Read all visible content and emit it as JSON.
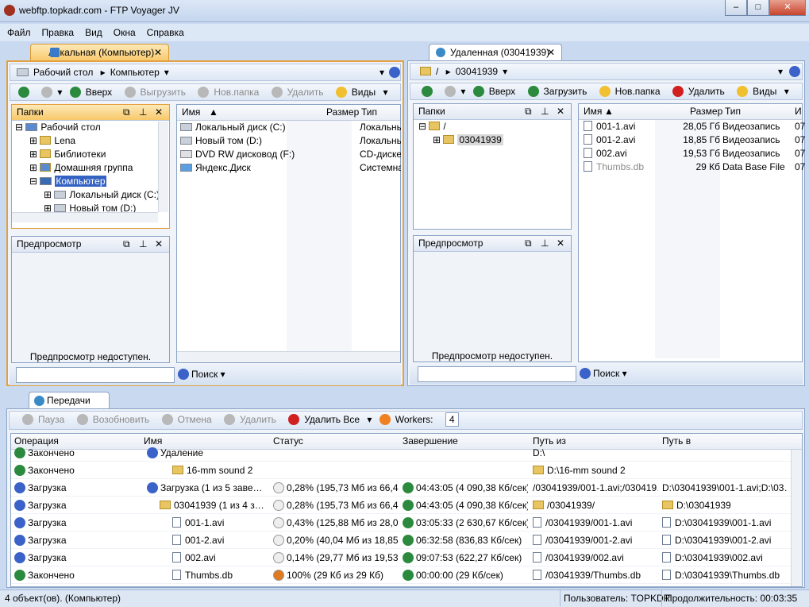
{
  "window": {
    "title": "webftp.topkadr.com - FTP Voyager JV",
    "min": "–",
    "max": "□",
    "close": "✕"
  },
  "menu": [
    "Файл",
    "Правка",
    "Вид",
    "Окна",
    "Справка"
  ],
  "local": {
    "tab": "Локальная (Компьютер)",
    "path": [
      "Рабочий стол",
      "Компьютер"
    ],
    "toolbar": [
      "Вверх",
      "Выгрузить",
      "Нов.папка",
      "Удалить",
      "Виды"
    ],
    "folders_title": "Папки",
    "tree": [
      "Рабочий стол",
      "Lena",
      "Библиотеки",
      "Домашняя группа",
      "Компьютер",
      "Локальный диск (C:)",
      "Новый том (D:)"
    ],
    "preview_title": "Предпросмотр",
    "preview_text": "Предпросмотр недоступен.",
    "columns": [
      "Имя",
      "Размер",
      "Тип"
    ],
    "files": [
      {
        "name": "Локальный диск (C:)",
        "size": "",
        "type": "Локальны"
      },
      {
        "name": "Новый том (D:)",
        "size": "",
        "type": "Локальны"
      },
      {
        "name": "DVD RW дисковод (F:)",
        "size": "",
        "type": "CD-диске"
      },
      {
        "name": "Яндекс.Диск",
        "size": "",
        "type": "Системна"
      }
    ],
    "search_label": "Поиск"
  },
  "remote": {
    "tab": "Удаленная (03041939)",
    "path": [
      "/",
      "03041939"
    ],
    "toolbar": [
      "Вверх",
      "Загрузить",
      "Нов.папка",
      "Удалить",
      "Виды"
    ],
    "folders_title": "Папки",
    "tree": [
      "/",
      "03041939"
    ],
    "preview_title": "Предпросмотр",
    "preview_text": "Предпросмотр недоступен.",
    "columns": [
      "Имя",
      "Размер",
      "Тип",
      "И"
    ],
    "files": [
      {
        "name": "001-1.avi",
        "size": "28,05 Гб",
        "type": "Видеозапись",
        "extra": "07"
      },
      {
        "name": "001-2.avi",
        "size": "18,85 Гб",
        "type": "Видеозапись",
        "extra": "07"
      },
      {
        "name": "002.avi",
        "size": "19,53 Гб",
        "type": "Видеозапись",
        "extra": "07"
      },
      {
        "name": "Thumbs.db",
        "size": "29 Кб",
        "type": "Data Base File",
        "extra": "07"
      }
    ],
    "search_label": "Поиск"
  },
  "transfers": {
    "tab": "Передачи",
    "toolbar": [
      "Пауза",
      "Возобновить",
      "Отмена",
      "Удалить",
      "Удалить Все"
    ],
    "workers_label": "Workers:",
    "workers_value": "4",
    "columns": [
      "Операция",
      "Имя",
      "Статус",
      "Завершение",
      "Путь из",
      "Путь в"
    ],
    "rows": [
      {
        "op": "Закончено",
        "name": "Удаление",
        "status": "",
        "finish": "",
        "from": "D:\\",
        "to": "",
        "icon": "g"
      },
      {
        "op": "Закончено",
        "name": "16-mm sound 2",
        "status": "",
        "finish": "",
        "from": "D:\\16-mm sound 2",
        "to": "",
        "icon": "g"
      },
      {
        "op": "Загрузка",
        "name": "Загрузка  (1 из 5 заве…",
        "status": "0,28% (195,73 Мб из 66,4…",
        "finish": "04:43:05 (4 090,38 Кб/сек)",
        "from": "/03041939/001-1.avi;/030419…",
        "to": "D:\\03041939\\001-1.avi;D:\\03…",
        "icon": "b"
      },
      {
        "op": "Загрузка",
        "name": "03041939 (1 из 4 з…",
        "status": "0,28% (195,73 Мб из 66,4…",
        "finish": "04:43:05 (4 090,38 Кб/сек)",
        "from": "/03041939/",
        "to": "D:\\03041939",
        "icon": "b"
      },
      {
        "op": "Загрузка",
        "name": "001-1.avi",
        "status": "0,43% (125,88 Мб из 28,0…",
        "finish": "03:05:33 (2 630,67 Кб/сек)",
        "from": "/03041939/001-1.avi",
        "to": "D:\\03041939\\001-1.avi",
        "icon": "b"
      },
      {
        "op": "Загрузка",
        "name": "001-2.avi",
        "status": "0,20% (40,04 Мб из 18,85…",
        "finish": "06:32:58 (836,83 Кб/сек)",
        "from": "/03041939/001-2.avi",
        "to": "D:\\03041939\\001-2.avi",
        "icon": "b"
      },
      {
        "op": "Загрузка",
        "name": "002.avi",
        "status": "0,14% (29,77 Мб из 19,53…",
        "finish": "09:07:53 (622,27 Кб/сек)",
        "from": "/03041939/002.avi",
        "to": "D:\\03041939\\002.avi",
        "icon": "b"
      },
      {
        "op": "Закончено",
        "name": "Thumbs.db",
        "status": "100% (29 Кб из 29 Кб)",
        "finish": "00:00:00 (29 Кб/сек)",
        "from": "/03041939/Thumbs.db",
        "to": "D:\\03041939\\Thumbs.db",
        "icon": "g"
      }
    ]
  },
  "statusbar": {
    "left": "4 объект(ов).  (Компьютер)",
    "user": "Пользователь: TOPKDR",
    "duration": "Продолжительность: 00:03:35"
  }
}
